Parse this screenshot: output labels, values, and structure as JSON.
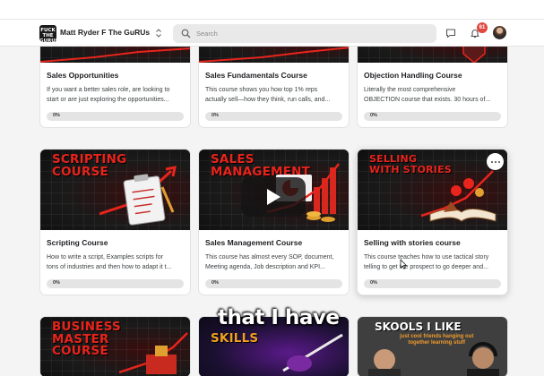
{
  "header": {
    "logo_text": "FUCK THE GURUS",
    "group_name": "Matt Ryder F The GuRUs",
    "search_placeholder": "Search",
    "notifications_count": "61"
  },
  "courses": [
    {
      "title": "Sales Opportunities",
      "thumbnail_text": "",
      "desc_line1": "If you want a better sales role, are looking to",
      "desc_line2": "start or are just exploring the opportunities...",
      "progress_label": "0%",
      "progress_value": 0
    },
    {
      "title": "Sales Fundamentals Course",
      "thumbnail_text": "",
      "desc_line1": "This course shows you how top 1% reps",
      "desc_line2": "actually sell—how they think, run calls, and...",
      "progress_label": "0%",
      "progress_value": 0
    },
    {
      "title": "Objection Handling Course",
      "thumbnail_text": "",
      "desc_line1": "Literally the most comprehensive",
      "desc_line2": "OBJECTION course that exists. 30 hours of...",
      "progress_label": "0%",
      "progress_value": 0
    },
    {
      "title": "Scripting Course",
      "thumbnail_text": "SCRIPTING\nCOURSE",
      "desc_line1": "How to write a script, Examples scripts for",
      "desc_line2": "tons of industries and then how to adapt it t...",
      "progress_label": "0%",
      "progress_value": 0
    },
    {
      "title": "Sales Management Course",
      "thumbnail_text": "SALES\nMANAGEMENT",
      "desc_line1": "This course has almost every SOP, document,",
      "desc_line2": "Meeting agenda, Job description and KPI...",
      "progress_label": "0%",
      "progress_value": 0
    },
    {
      "title": "Selling with stories course",
      "thumbnail_text": "SELLING\nWITH STORIES",
      "desc_line1": "This course teaches how to use tactical story",
      "desc_line2": "telling to get the prospect to go deeper and...",
      "progress_label": "0%",
      "progress_value": 0
    },
    {
      "title": "",
      "thumbnail_text": "BUSINESS\nMASTER\nCOURSE"
    },
    {
      "title": "",
      "thumbnail_text": "SKILLS"
    },
    {
      "title": "",
      "thumbnail_text": "SKOOLS I LIKE",
      "thumbnail_subtext": "just cool friends hanging out\ntogether learning stuff"
    }
  ],
  "video_caption": "that I have",
  "colors": {
    "accent_red": "#e8241c",
    "badge_red": "#e0483e",
    "progress_track": "#e4e4e4"
  }
}
